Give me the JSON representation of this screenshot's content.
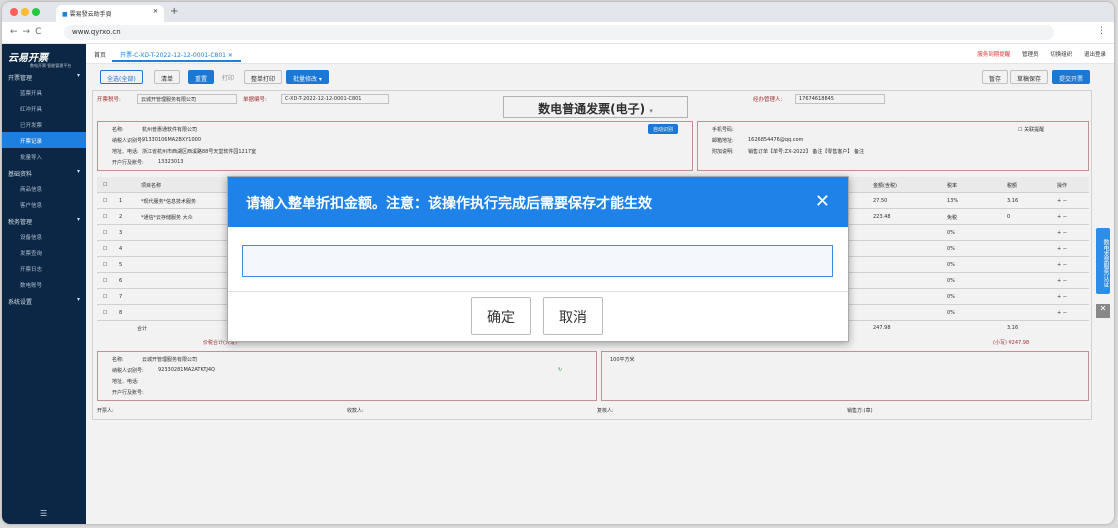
{
  "browser": {
    "tab_title": "雲易發云助手頁",
    "url": "www.qyrxo.cn"
  },
  "sidebar": {
    "logo": "云易开票",
    "logo_sub": "数电开票·智能管理平台",
    "groups": [
      {
        "label": "开票管理",
        "items": [
          "蓝票开具",
          "红冲开具",
          "已开发票",
          "开票记录",
          "批量导入"
        ]
      },
      {
        "label": "基础资料",
        "items": [
          "商品信息",
          "客户信息"
        ]
      },
      {
        "label": "税务管理",
        "items": [
          "设备信息",
          "发票查询",
          "开票日志",
          "数电账号"
        ]
      },
      {
        "label": "系统设置",
        "items": []
      }
    ],
    "active_item": "开票记录"
  },
  "topnav": {
    "home": "首页",
    "tab": "开票-C-XD-T-2022-12-12-0001-C801",
    "right": [
      "服务到期提醒",
      "管理员",
      "切换组织",
      "退出登录"
    ]
  },
  "toolbar": {
    "buttons": [
      "全选(全部)",
      "清单",
      "重置",
      "打印",
      "整单打印",
      "批量修改"
    ],
    "right_buttons": [
      "暂存",
      "草稿保存",
      "提交开票"
    ]
  },
  "form": {
    "seller_tax_label": "开票税号:",
    "seller_tax_value": "云城开管理服务有限公司",
    "invoice_no_label": "单据编号:",
    "invoice_no_value": "C-XD-T-2022-12-12-0001-C801",
    "invoice_title": "数电普通发票(电子)",
    "reviewer_label": "经办管理人:",
    "reviewer_value": "17674618845",
    "buyer_name_label": "名称:",
    "buyer_name": "杭州普惠通软件有限公司",
    "buyer_tax_label": "纳税人识别号:",
    "buyer_tax": "91330106MA2BXY1000",
    "buyer_addr_label": "地址、电话:",
    "buyer_addr": "浙江省杭州市西湖区西溪路88号天堂软件园1217室",
    "buyer_bank_label": "开户行及账号:",
    "buyer_bank": "13323013",
    "auto_fill": "自动识别",
    "mobile_label": "手机号码:",
    "email_label": "邮箱地址:",
    "email_value": "1626854476@qq.com",
    "remark_label": "附加说明:",
    "remark_value": "销售订单【单号:ZX-2022】 备注【零售客户】 备注",
    "checkbox_label": "关联提醒"
  },
  "table": {
    "headers": [
      "",
      "序号",
      "项目名称",
      "金额(含税)",
      "税率",
      "税额",
      "操作"
    ],
    "rows": [
      {
        "no": "1",
        "name": "*现代服务*信息技术服务",
        "amount": "27.50",
        "rate": "13%",
        "tax": "3.16"
      },
      {
        "no": "2",
        "name": "*通信*云存储服务 大众",
        "amount": "223.48",
        "rate": "免税",
        "tax": "0"
      },
      {
        "no": "3",
        "name": "",
        "amount": "",
        "rate": "0%",
        "tax": ""
      },
      {
        "no": "4",
        "name": "",
        "amount": "",
        "rate": "0%",
        "tax": ""
      },
      {
        "no": "5",
        "name": "",
        "amount": "",
        "rate": "0%",
        "tax": ""
      },
      {
        "no": "6",
        "name": "",
        "amount": "",
        "rate": "0%",
        "tax": ""
      },
      {
        "no": "7",
        "name": "",
        "amount": "",
        "rate": "0%",
        "tax": ""
      },
      {
        "no": "8",
        "name": "",
        "amount": "",
        "rate": "0%",
        "tax": ""
      }
    ],
    "total_label": "合计",
    "total_amount": "247.98",
    "total_tax": "3.16",
    "price_tax_label": "价税合计(大写)",
    "price_tax_total": "(小写) ¥247.98"
  },
  "seller": {
    "name_label": "名称:",
    "name": "云城开管理服务有限公司",
    "tax_label": "纳税人识别号:",
    "tax": "92330281MA2ATKTJ4Q",
    "addr_label": "地址、电话:",
    "bank_label": "开户行及账号:",
    "remark": "100平方米"
  },
  "footer": {
    "payee": "开票人:",
    "reviewer": "收款人:",
    "checker": "复核人:",
    "issuer": "销售方:(章)"
  },
  "modal": {
    "title": "请输入整单折扣金额。注意：该操作执行完成后需要保存才能生效",
    "input_value": "",
    "confirm": "确定",
    "cancel": "取消"
  },
  "side_float": {
    "label": "数电发票服务认证"
  }
}
